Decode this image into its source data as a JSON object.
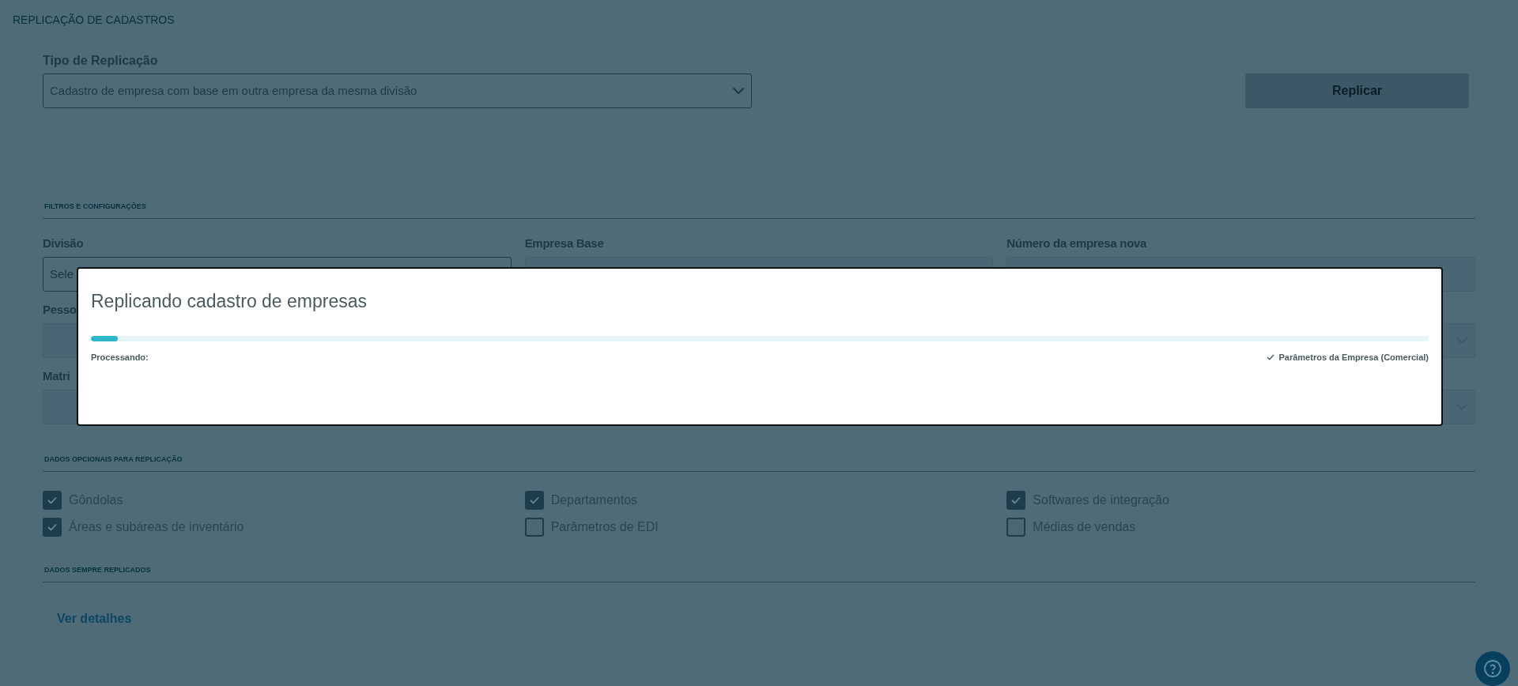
{
  "page": {
    "title": "REPLICAÇÃO DE CADASTROS"
  },
  "replication_type": {
    "label": "Tipo de Replicação",
    "value": "Cadastro de empresa com base em outra empresa da mesma divisão"
  },
  "replicate_button": {
    "label": "Replicar",
    "disabled": true
  },
  "filters": {
    "heading": "FILTROS E CONFIGURAÇÕES",
    "rows": [
      [
        {
          "label": "Divisão",
          "placeholder": "Sele",
          "disabled": false
        },
        {
          "label": "Empresa Base",
          "disabled": true
        },
        {
          "label": "Número da empresa nova",
          "disabled": true
        }
      ],
      [
        {
          "label": "Pesso",
          "disabled": true
        },
        null,
        {
          "disabled": true,
          "dropdown": true
        }
      ],
      [
        {
          "label": "Matri",
          "disabled": true
        },
        null,
        {
          "disabled": true,
          "dropdown": true
        }
      ]
    ]
  },
  "optional_data": {
    "heading": "DADOS OPCIONAIS PARA REPLICAÇÃO",
    "options": [
      {
        "label": "Gôndolas",
        "checked": true
      },
      {
        "label": "Departamentos",
        "checked": true
      },
      {
        "label": "Softwares de integração",
        "checked": true
      },
      {
        "label": "Áreas e subáreas de inventário",
        "checked": true
      },
      {
        "label": "Parâmetros de EDI",
        "checked": false
      },
      {
        "label": "Médias de vendas",
        "checked": false
      }
    ]
  },
  "always_replicated": {
    "heading": "DADOS SEMPRE REPLICADOS",
    "link": "Ver detalhes"
  },
  "modal": {
    "title": "Replicando cadastro de empresas",
    "progress": {
      "level": 0.02
    },
    "status_label": "Processando:",
    "current_step": "Parâmetros da Empresa (Comercial)"
  }
}
